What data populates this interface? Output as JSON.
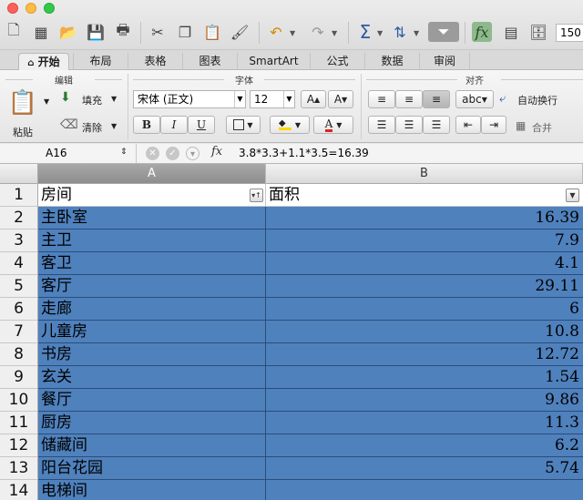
{
  "toolbar": {
    "zoom": "150",
    "icons": [
      "new-icon",
      "gallery-icon",
      "open-icon",
      "save-icon",
      "print-icon",
      "cut-icon",
      "copy-icon",
      "paste-icon",
      "format-painter-icon",
      "undo-icon",
      "redo-icon",
      "autosum-icon",
      "sort-icon",
      "filter-icon",
      "formula-builder-icon",
      "show-hide-icon",
      "toolbox-icon"
    ]
  },
  "ribbon_tabs": [
    {
      "label": "开始",
      "active": true
    },
    {
      "label": "布局"
    },
    {
      "label": "表格"
    },
    {
      "label": "图表"
    },
    {
      "label": "SmartArt"
    },
    {
      "label": "公式"
    },
    {
      "label": "数据"
    },
    {
      "label": "审阅"
    }
  ],
  "ribbon": {
    "groups": {
      "edit": "编辑",
      "font": "字体",
      "align": "对齐"
    },
    "paste_label": "粘贴",
    "fill_label": "填充",
    "clear_label": "清除",
    "font_name": "宋体 (正文)",
    "font_size": "12",
    "grow_font": "A",
    "shrink_font": "A",
    "bold": "B",
    "italic": "I",
    "underline": "U",
    "wrap_label": "自动换行",
    "merge_label": "合并",
    "abc_label": "abc",
    "colors": {
      "fill": "#ffd800",
      "font": "#e02020"
    }
  },
  "formula_bar": {
    "name_box": "A16",
    "fx": "fx",
    "formula": "3.8*3.3+1.1*3.5=16.39"
  },
  "sheet": {
    "columns": [
      "A",
      "B"
    ],
    "selected_column": "A",
    "header_row": {
      "row": "1",
      "a": "房间",
      "b": "面积"
    },
    "rows": [
      {
        "row": "2",
        "a": "主卧室",
        "b": "16.39"
      },
      {
        "row": "3",
        "a": "主卫",
        "b": "7.9"
      },
      {
        "row": "4",
        "a": "客卫",
        "b": "4.1"
      },
      {
        "row": "5",
        "a": "客厅",
        "b": "29.11"
      },
      {
        "row": "6",
        "a": "走廊",
        "b": "6"
      },
      {
        "row": "7",
        "a": "儿童房",
        "b": "10.8"
      },
      {
        "row": "8",
        "a": "书房",
        "b": "12.72"
      },
      {
        "row": "9",
        "a": "玄关",
        "b": "1.54"
      },
      {
        "row": "10",
        "a": "餐厅",
        "b": "9.86"
      },
      {
        "row": "11",
        "a": "厨房",
        "b": "11.3"
      },
      {
        "row": "12",
        "a": "储藏间",
        "b": "6.2"
      },
      {
        "row": "13",
        "a": "阳台花园",
        "b": "5.74"
      },
      {
        "row": "14",
        "a": "电梯间",
        "b": ""
      }
    ],
    "selection_color": "#4f81bd"
  }
}
